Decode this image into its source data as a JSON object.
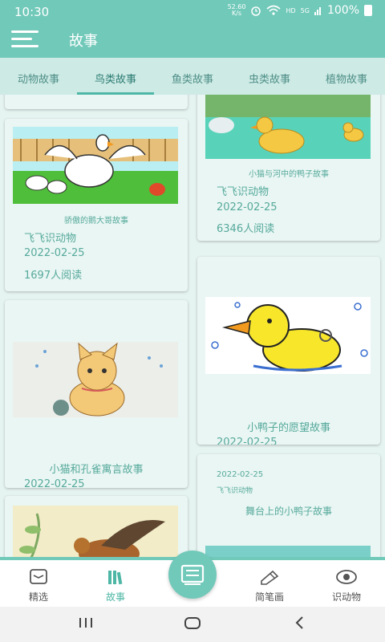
{
  "status_bar": {
    "time": "10:30",
    "net_speed_value": "52.60",
    "net_speed_unit": "K/s",
    "hd": "HD",
    "signal_label": "5G",
    "battery": "100%"
  },
  "app_bar": {
    "title": "故事"
  },
  "tabs": [
    {
      "label": "动物故事"
    },
    {
      "label": "鸟类故事"
    },
    {
      "label": "鱼类故事"
    },
    {
      "label": "虫类故事"
    },
    {
      "label": "植物故事"
    }
  ],
  "active_tab": "鸟类故事",
  "cards": [
    {
      "title": "骄傲的鹅大哥故事",
      "author": "飞飞识动物",
      "date": "2022-02-25",
      "reads": "1697人阅读"
    },
    {
      "title": "小猫与河中的鸭子故事",
      "author": "飞飞识动物",
      "date": "2022-02-25",
      "reads": "6346人阅读"
    },
    {
      "title": "小猫和孔雀寓言故事",
      "date": "2022-02-25"
    },
    {
      "title": "小鸭子的愿望故事",
      "date": "2022-02-25"
    },
    {
      "title": "舞台上的小鸭子故事",
      "author": "飞飞识动物",
      "date": "2022-02-25"
    }
  ],
  "bottom_nav": [
    {
      "label": "精选",
      "icon": "featured-icon"
    },
    {
      "label": "故事",
      "icon": "stories-icon"
    },
    {
      "label": "",
      "icon": "book-icon"
    },
    {
      "label": "简笔画",
      "icon": "drawing-icon"
    },
    {
      "label": "识动物",
      "icon": "eye-icon"
    }
  ],
  "colors": {
    "primary": "#71c9b9",
    "accent": "#4fb7a6",
    "text": "#56a99c"
  }
}
